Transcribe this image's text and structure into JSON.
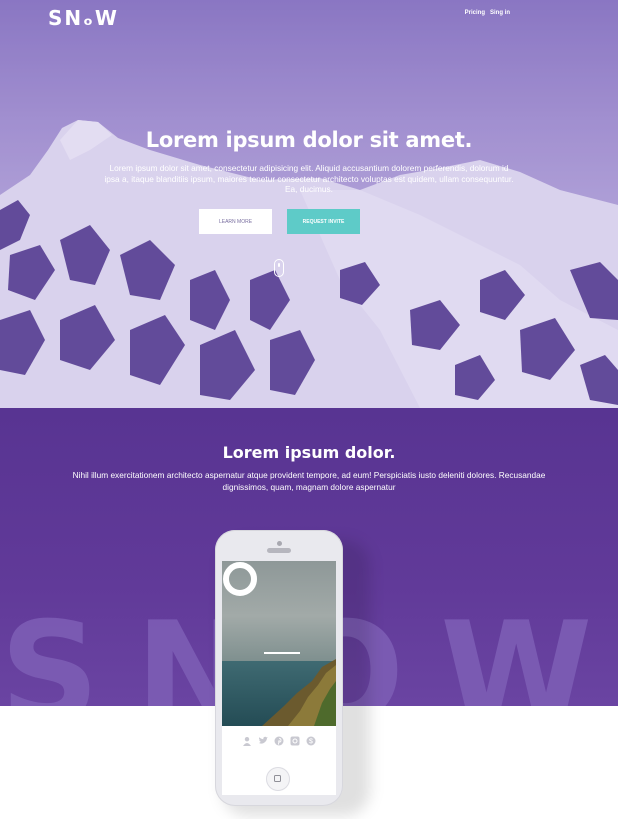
{
  "brand": {
    "logo": "SNₒW"
  },
  "nav": {
    "items": [
      "Pricing",
      "Sing in"
    ]
  },
  "hero": {
    "title": "Lorem ipsum dolor sit amet.",
    "subtitle": "Lorem ipsum dolor sit amet, consectetur adipisicing elit. Aliquid accusantium dolorem perferendis, dolorum id ipsa a, itaque blanditiis ipsum, maiores tenetur consectetur architecto voluptas est quidem, ullam consequuntur. Ea, ducimus.",
    "learn_more_label": "LEARN MORE",
    "request_invite_label": "REQUEST INVITE"
  },
  "feature": {
    "title": "Lorem ipsum dolor.",
    "text": "Nihil illum exercitationem architecto aspernatur atque provident tempore, ad eum! Perspiciatis iusto deleniti dolores. Recusandae dignissimos, quam, magnam dolore aspernatur",
    "background_word": "SNOW"
  },
  "phone": {
    "social_icons": [
      "user-icon",
      "twitter-icon",
      "pinterest-icon",
      "instagram-icon",
      "skype-icon"
    ]
  },
  "colors": {
    "hero_overlay": "#9c88cf",
    "feature_bg": "#5f3896",
    "accent_teal": "#5ecbc8",
    "white": "#ffffff"
  }
}
